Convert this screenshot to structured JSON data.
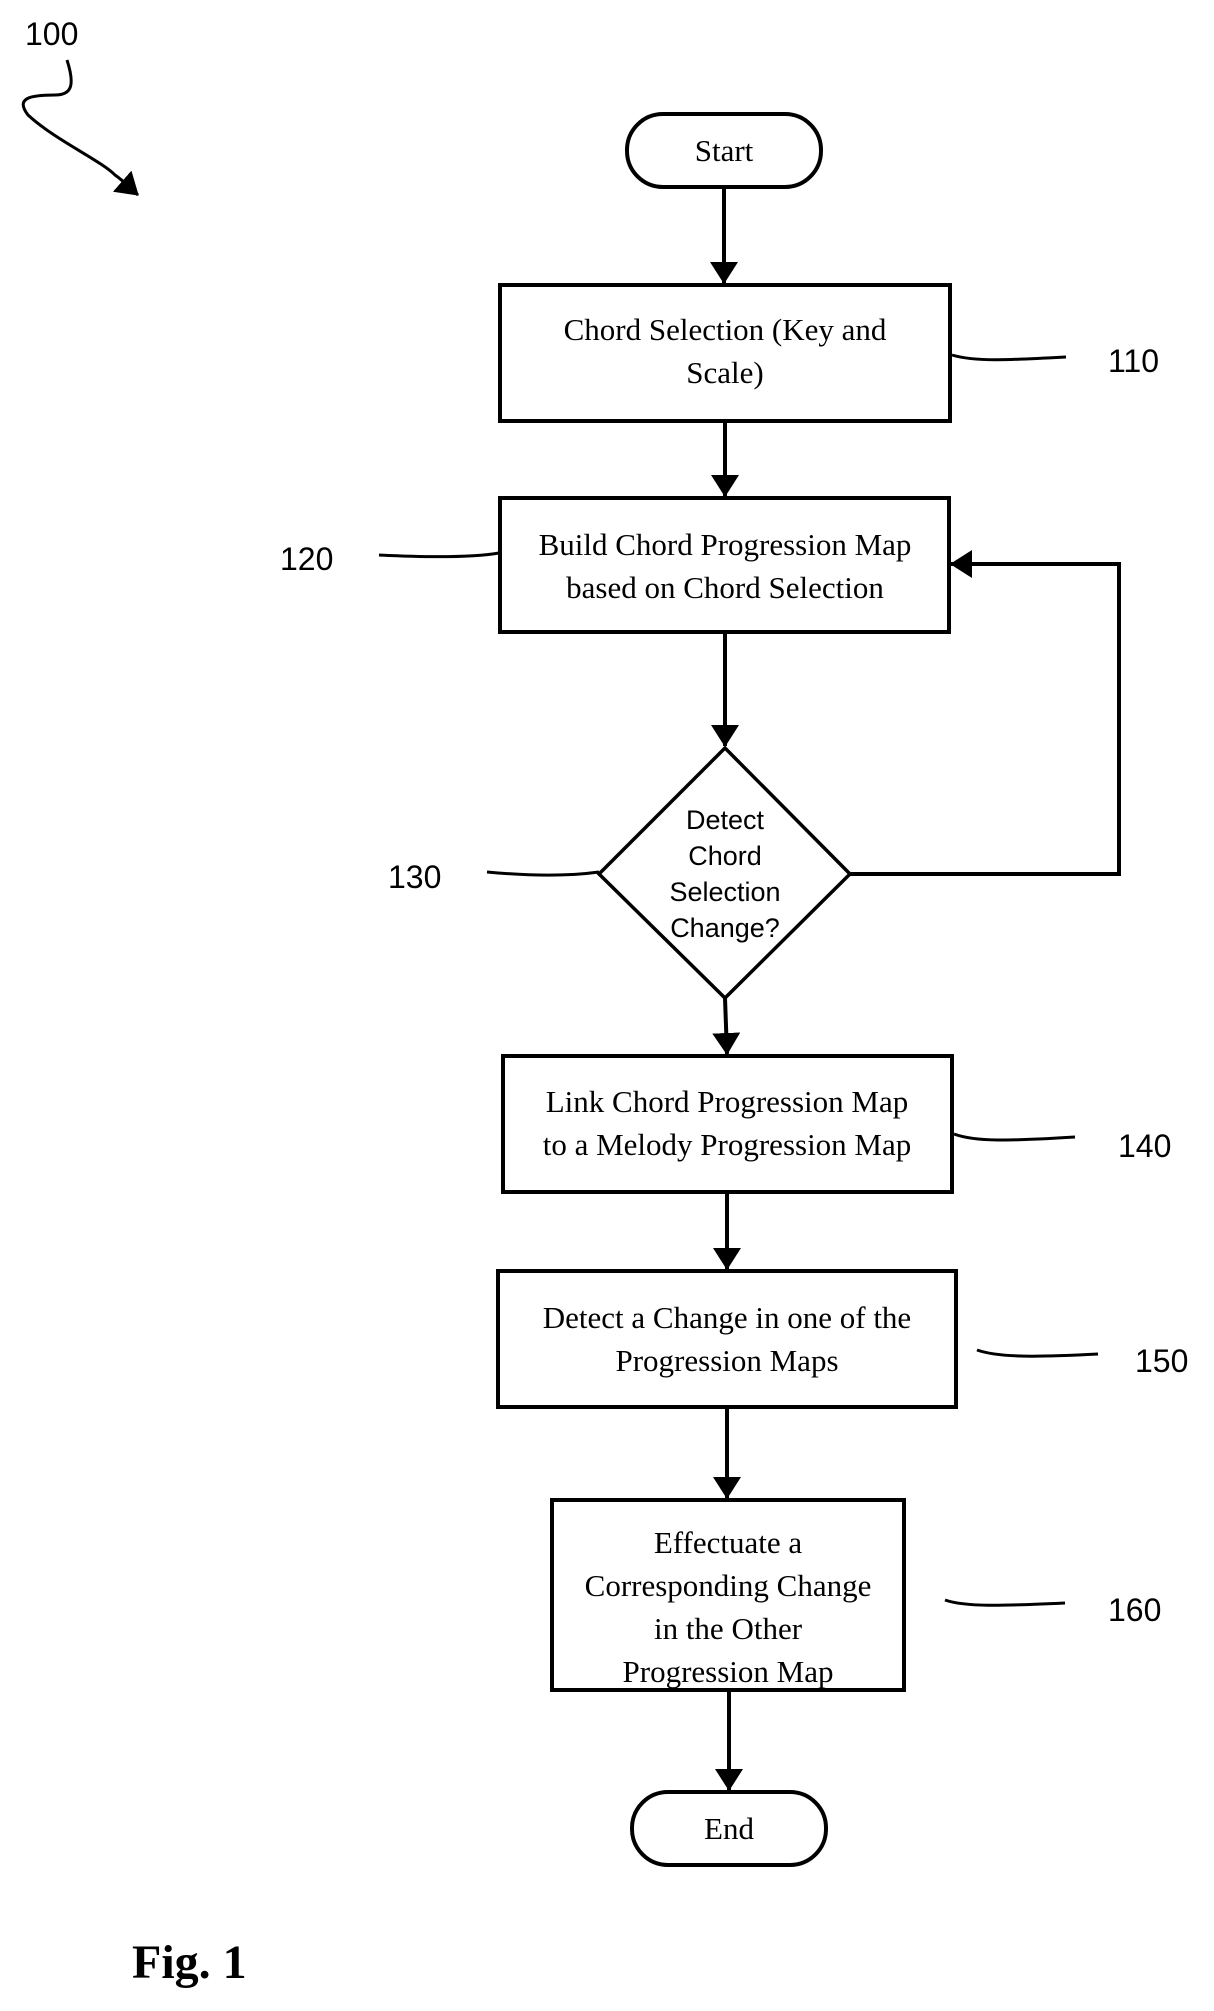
{
  "figure": {
    "ref_number": "100",
    "caption": "Fig. 1"
  },
  "nodes": {
    "start": {
      "label": "Start"
    },
    "step_110": {
      "ref": "110",
      "lines": [
        "Chord Selection (Key and",
        "Scale)"
      ]
    },
    "step_120": {
      "ref": "120",
      "lines": [
        "Build Chord Progression Map",
        "based on Chord Selection"
      ]
    },
    "decision_130": {
      "ref": "130",
      "lines": [
        "Detect",
        "Chord",
        "Selection",
        "Change?"
      ]
    },
    "step_140": {
      "ref": "140",
      "lines": [
        "Link Chord Progression Map",
        "to a Melody Progression Map"
      ]
    },
    "step_150": {
      "ref": "150",
      "lines": [
        "Detect a Change in one of the",
        "Progression Maps"
      ]
    },
    "step_160": {
      "ref": "160",
      "lines": [
        "Effectuate a",
        "Corresponding Change",
        "in the Other",
        "Progression Map"
      ]
    },
    "end": {
      "label": "End"
    }
  }
}
